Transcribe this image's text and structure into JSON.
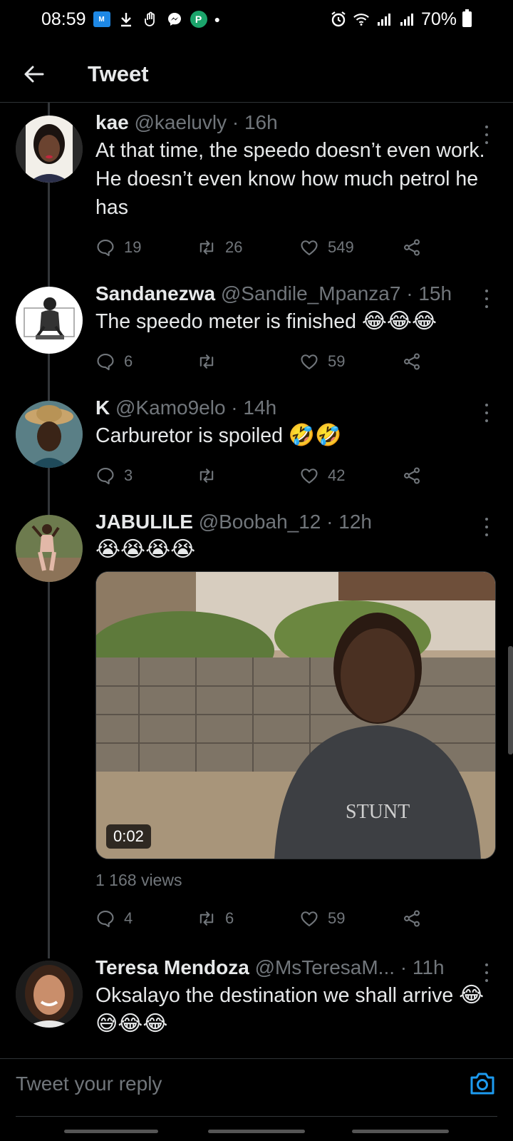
{
  "status_bar": {
    "time": "08:59",
    "battery": "70%",
    "left_icons": [
      "hi-movies-icon",
      "download-icon",
      "hand-icon",
      "messenger-icon",
      "p-app-icon",
      "dot-icon"
    ],
    "right_icons": [
      "alarm-icon",
      "wifi-icon",
      "signal-icon",
      "signal-icon",
      "battery-icon"
    ],
    "mmov_label": "M",
    "p_label": "P"
  },
  "header": {
    "title": "Tweet",
    "back_icon": "arrow-left-icon"
  },
  "tweets": [
    {
      "name": "kae",
      "handle": "@kaeluvly",
      "time": "16h",
      "separator": " · ",
      "text": "At that time, the speedo doesn’t even work. He doesn’t even know how much petrol he has",
      "emojis": "",
      "replies": "19",
      "retweets": "26",
      "likes": "549"
    },
    {
      "name": "Sandanezwa",
      "handle": "@Sandile_Mpanza7",
      "time": "15h",
      "separator": " · ",
      "text": "The speedo meter is finished ",
      "emojis": "😂😂😂",
      "replies": "6",
      "retweets": "",
      "likes": "59"
    },
    {
      "name": "K",
      "handle": "@Kamo9elo",
      "time": "14h",
      "separator": " · ",
      "text": "Carburetor is spoiled ",
      "emojis": "🤣🤣",
      "replies": "3",
      "retweets": "",
      "likes": "42"
    },
    {
      "name": "JABULILE",
      "handle": "@Boobah_12",
      "time": "12h",
      "separator": " · ",
      "text": "",
      "emojis": "😭😭😭😭",
      "video_duration": "0:02",
      "video_overlay": "STUNT",
      "views": "1 168 views",
      "replies": "4",
      "retweets": "6",
      "likes": "59"
    },
    {
      "name": "Teresa Mendoza",
      "handle": "@MsTeresaM...",
      "time": "11h",
      "separator": " · ",
      "text": "Oksalayo the destination we shall arrive ",
      "emojis": "😂😅😂😂"
    }
  ],
  "reply": {
    "placeholder": "Tweet your reply",
    "camera_icon": "camera-icon"
  },
  "colors": {
    "background": "#000000",
    "text_primary": "#e7e9ea",
    "text_secondary": "#71767b",
    "accent": "#1d9bf0"
  }
}
